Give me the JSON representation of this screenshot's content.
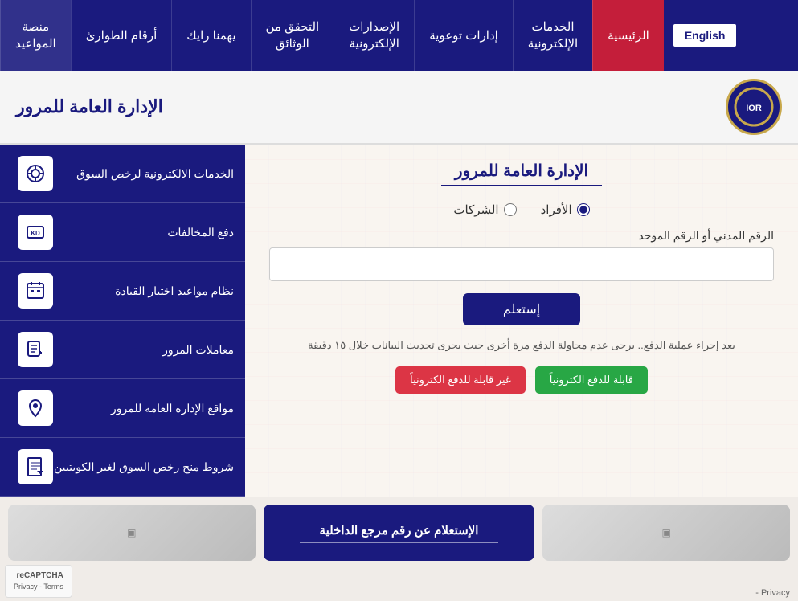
{
  "nav": {
    "english_label": "English",
    "items": [
      {
        "id": "home",
        "label": "الرئيسية",
        "active": true
      },
      {
        "id": "eservices",
        "label": "الخدمات\nالإلكترونية"
      },
      {
        "id": "awareness",
        "label": "إدارات توعوية"
      },
      {
        "id": "issuances",
        "label": "الإصدارات\nالإلكترونية"
      },
      {
        "id": "verify",
        "label": "التحقق من\nالوثائق"
      },
      {
        "id": "feedback",
        "label": "يهمنا رايك"
      },
      {
        "id": "emergency",
        "label": "أرقام الطوارئ"
      },
      {
        "id": "platform",
        "label": "منصة\nالمواعيد"
      }
    ]
  },
  "header": {
    "title": "الإدارة العامة للمرور",
    "logo_text": "IOR"
  },
  "form": {
    "title": "الإدارة العامة للمرور",
    "radio_individuals": "الأفراد",
    "radio_companies": "الشركات",
    "field_label": "الرقم المدني أو الرقم الموحد",
    "submit_label": "إستعلم",
    "info_text": "بعد إجراء عملية الدفع.. يرجى عدم محاولة الدفع مرة أخرى حيث يجرى تحديث البيانات خلال ١٥ دقيقة",
    "btn_payment": "قابلة للدفع الكترونياً",
    "btn_payment_counter": "غير قابلة للدفع الكترونياً"
  },
  "sidebar": {
    "items": [
      {
        "id": "vehicle-license",
        "label": "الخدمات الالكترونية لرخص السوق",
        "icon": "🔍"
      },
      {
        "id": "pay-violations",
        "label": "دفع المخالفات",
        "icon": "💳"
      },
      {
        "id": "driving-schedule",
        "label": "نظام مواعيد اختبار القيادة",
        "icon": "📋"
      },
      {
        "id": "transactions",
        "label": "معاملات المرور",
        "icon": "📝"
      },
      {
        "id": "locations",
        "label": "مواقع الإدارة العامة للمرور",
        "icon": "📍"
      },
      {
        "id": "conditions",
        "label": "شروط منح رخص السوق لغير الكويتيين",
        "icon": "📄"
      }
    ]
  },
  "bottom": {
    "center_title": "الإستعلام عن رقم مرجع الداخلية"
  },
  "footer": {
    "privacy_label": "Privacy -"
  },
  "recaptcha": {
    "label": "reCAPTCHA",
    "privacy_label": "Privacy - Terms"
  }
}
